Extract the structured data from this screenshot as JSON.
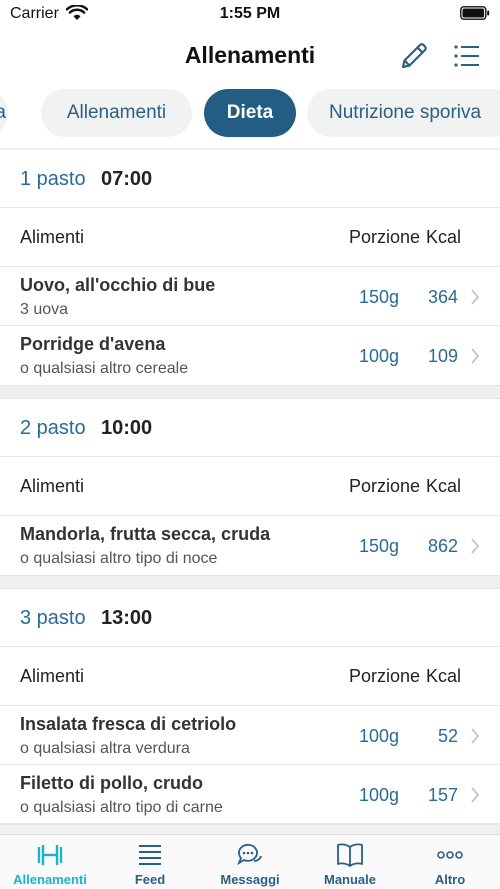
{
  "status_bar": {
    "carrier": "Carrier",
    "time": "1:55 PM"
  },
  "nav": {
    "title": "Allenamenti",
    "edit_icon": "pencil-icon",
    "list_icon": "list-icon"
  },
  "tabs": [
    {
      "label": "a",
      "active": false
    },
    {
      "label": "Allenamenti",
      "active": false
    },
    {
      "label": "Dieta",
      "active": true
    },
    {
      "label": "Nutrizione sporiva",
      "active": false
    }
  ],
  "columns": {
    "foods": "Alimenti",
    "portion": "Porzione",
    "kcal": "Kcal"
  },
  "meals": [
    {
      "label": "1 pasto",
      "time": "07:00",
      "foods": [
        {
          "name": "Uovo, all'occhio di bue",
          "sub": "3 uova",
          "portion": "150g",
          "kcal": "364"
        },
        {
          "name": "Porridge d'avena",
          "sub": "o qualsiasi altro cereale",
          "portion": "100g",
          "kcal": "109"
        }
      ]
    },
    {
      "label": "2 pasto",
      "time": "10:00",
      "foods": [
        {
          "name": "Mandorla, frutta secca, cruda",
          "sub": "o qualsiasi altro tipo di noce",
          "portion": "150g",
          "kcal": "862"
        }
      ]
    },
    {
      "label": "3 pasto",
      "time": "13:00",
      "foods": [
        {
          "name": "Insalata fresca di cetriolo",
          "sub": "o qualsiasi altra verdura",
          "portion": "100g",
          "kcal": "52"
        },
        {
          "name": "Filetto di pollo, crudo",
          "sub": "o qualsiasi altro tipo di carne",
          "portion": "100g",
          "kcal": "157"
        }
      ]
    }
  ],
  "tabbar": [
    {
      "label": "Allenamenti",
      "icon": "dumbbell-icon",
      "active": true
    },
    {
      "label": "Feed",
      "icon": "feed-icon",
      "active": false
    },
    {
      "label": "Messaggi",
      "icon": "chat-icon",
      "active": false
    },
    {
      "label": "Manuale",
      "icon": "book-icon",
      "active": false
    },
    {
      "label": "Altro",
      "icon": "more-icon",
      "active": false
    }
  ],
  "colors": {
    "accent": "#235d83",
    "link": "#2b6a94",
    "tab_active": "#1bb3c9",
    "tab_inactive": "#2b5f84"
  }
}
